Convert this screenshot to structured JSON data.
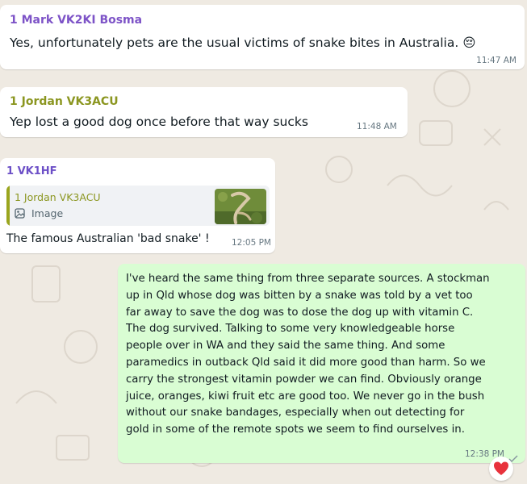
{
  "messages": [
    {
      "sender": "1 Mark VK2KI Bosma",
      "sender_color": "#7d53c7",
      "text": "Yes, unfortunately pets are the usual victims of snake bites in Australia.",
      "emoji": "😔",
      "time": "11:47 AM"
    },
    {
      "sender": "1 Jordan VK3ACU",
      "sender_color": "#8b9620",
      "text": "Yep lost a good dog once before that way sucks",
      "time": "11:48 AM"
    },
    {
      "sender": "1 VK1HF",
      "sender_color": "#6c4fc7",
      "quote": {
        "sender": "1 Jordan VK3ACU",
        "type_label": "Image",
        "icon": "image-icon"
      },
      "text": "The famous Australian 'bad snake' !",
      "time": "12:05 PM"
    },
    {
      "outgoing": true,
      "lines": [
        "I've heard the same thing from three separate sources. A stockman",
        "up in Qld whose dog was bitten by a snake was told by a vet too",
        "far away to save the dog was to dose the dog up with vitamin C.",
        "The dog survived. Talking to some very knowledgeable horse",
        "people over in WA and they said the same thing. And some",
        "paramedics in outback Qld said it did more good than harm. So we",
        "carry the strongest vitamin powder we  can find. Obviously orange",
        "juice, oranges, kiwi fruit etc are good too. We never go in the bush",
        "without our snake bandages, especially when out detecting for",
        "gold in some of the remote spots we seem to find ourselves in."
      ],
      "time": "12:38 PM",
      "status_icon": "check-icon",
      "reaction": "❤️"
    }
  ]
}
